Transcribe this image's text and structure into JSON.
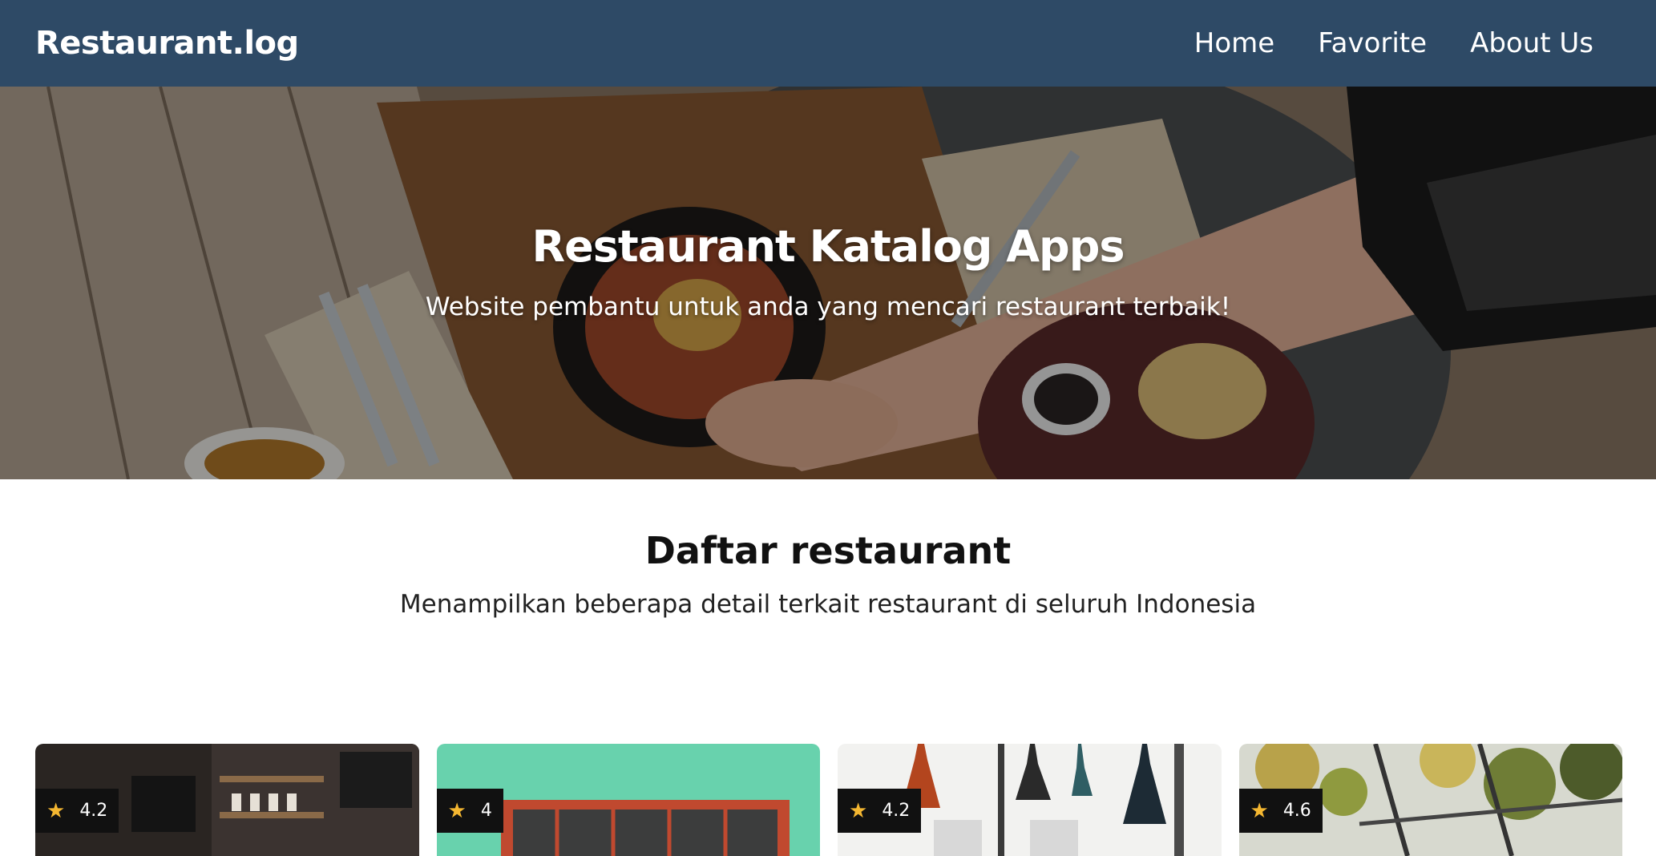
{
  "navbar": {
    "brand": "Restaurant.log",
    "links": [
      {
        "label": "Home"
      },
      {
        "label": "Favorite"
      },
      {
        "label": "About Us"
      }
    ]
  },
  "hero": {
    "title": "Restaurant Katalog Apps",
    "subtitle": "Website pembantu untuk anda yang mencari restaurant terbaik!"
  },
  "section": {
    "title": "Daftar restaurant",
    "subtitle": "Menampilkan beberapa detail terkait restaurant di seluruh Indonesia"
  },
  "restaurants": [
    {
      "rating": "4.2",
      "star_icon": "star-icon"
    },
    {
      "rating": "4",
      "star_icon": "star-icon"
    },
    {
      "rating": "4.2",
      "star_icon": "star-icon"
    },
    {
      "rating": "4.6",
      "star_icon": "star-icon"
    }
  ],
  "colors": {
    "navbar": "#2e4a66",
    "star": "#f4b731",
    "rating_badge": "#111111"
  }
}
